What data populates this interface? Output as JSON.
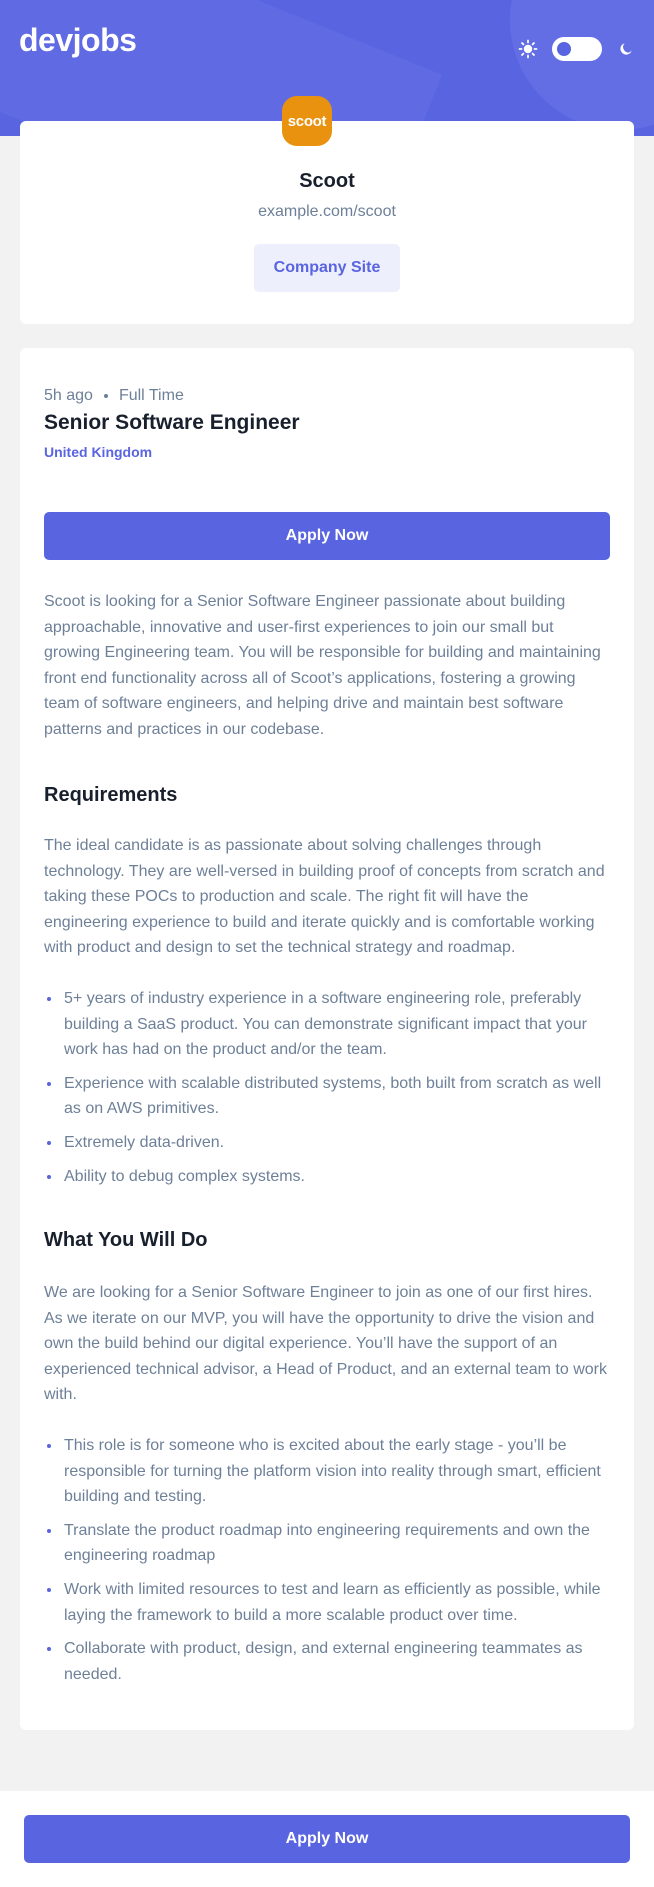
{
  "header": {
    "logo": "devjobs",
    "theme_toggle": {
      "light_icon": "sun-icon",
      "dark_icon": "moon-icon",
      "mode": "light"
    }
  },
  "company": {
    "logo_text": "scoot",
    "logo_color": "#e99210",
    "name": "Scoot",
    "url": "example.com/scoot",
    "site_button_label": "Company Site"
  },
  "job": {
    "posted": "5h ago",
    "contract": "Full Time",
    "title": "Senior Software Engineer",
    "location": "United Kingdom",
    "apply_label": "Apply Now",
    "description": "Scoot is looking for a Senior Software Engineer passionate about building approachable, innovative and user-first experiences to join our small but growing Engineering team. You will be responsible for building and maintaining front end functionality across all of Scoot’s applications, fostering a growing team of software engineers, and helping drive and maintain best software patterns and practices in our codebase.",
    "requirements": {
      "heading": "Requirements",
      "content": "The ideal candidate is as passionate about solving challenges through technology. They are well-versed in building proof of concepts from scratch and taking these POCs to production and scale. The right fit will have the engineering experience to build and iterate quickly and is comfortable working with product and design to set the technical strategy and roadmap.",
      "items": [
        "5+ years of industry experience in a software engineering role, preferably building a SaaS product. You can demonstrate significant impact that your work has had on the product and/or the team.",
        "Experience with scalable distributed systems, both built from scratch as well as on AWS primitives.",
        "Extremely data-driven.",
        "Ability to debug complex systems."
      ]
    },
    "role": {
      "heading": "What You Will Do",
      "content": "We are looking for a Senior Software Engineer to join as one of our first hires. As we iterate on our MVP, you will have the opportunity to drive the vision and own the build behind our digital experience. You’ll have the support of an experienced technical advisor, a Head of Product, and an external team to work with.",
      "items": [
        "This role is for someone who is excited about the early stage - you’ll be responsible for turning the platform vision into reality through smart, efficient building and testing.",
        "Translate the product roadmap into engineering requirements and own the engineering roadmap",
        "Work with limited resources to test and learn as efficiently as possible, while laying the framework to build a more scalable product over time.",
        "Collaborate with product, design, and external engineering teammates as needed."
      ]
    }
  },
  "footer": {
    "apply_label": "Apply Now"
  },
  "colors": {
    "accent": "#5964e0",
    "heading": "#19202d",
    "text": "#6e8098",
    "background": "#f2f2f2"
  }
}
